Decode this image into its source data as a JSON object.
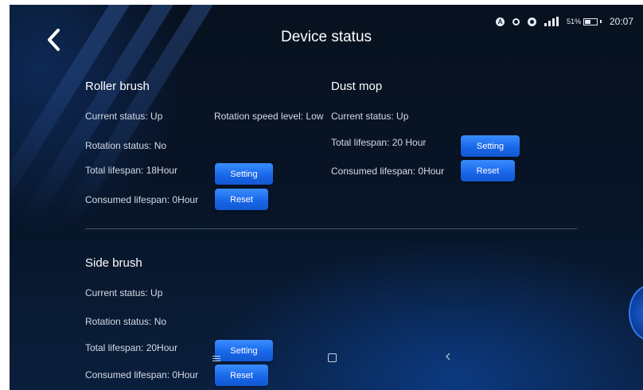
{
  "page": {
    "title": "Device status"
  },
  "status_bar": {
    "a_label": "A",
    "battery": "51%",
    "battery_level": 0.51,
    "time": "20:07"
  },
  "roller_brush": {
    "title": "Roller brush",
    "current_status": "Current status: Up",
    "rotation_speed": "Rotation speed level: Low",
    "rotation_status": "Rotation status: No",
    "total_lifespan": "Total lifespan: 18Hour",
    "consumed_lifespan": "Consumed lifespan: 0Hour",
    "setting_label": "Setting",
    "reset_label": "Reset"
  },
  "dust_mop": {
    "title": "Dust mop",
    "current_status": "Current status: Up",
    "total_lifespan": "Total lifespan: 20 Hour",
    "consumed_lifespan": "Consumed lifespan: 0Hour",
    "setting_label": "Setting",
    "reset_label": "Reset"
  },
  "side_brush": {
    "title": "Side brush",
    "current_status": "Current status: Up",
    "rotation_status": "Rotation status: No",
    "total_lifespan": "Total lifespan: 20Hour",
    "consumed_lifespan": "Consumed lifespan: 0Hour",
    "setting_label": "Setting",
    "reset_label": "Reset"
  },
  "icons": {
    "back": "chevron-left-icon",
    "menu": "menu-icon",
    "home": "square-icon",
    "nav_back": "chevron-left-icon"
  },
  "colors": {
    "button": "#1f6ff0",
    "background": "#081528",
    "text": "#ffffff"
  }
}
